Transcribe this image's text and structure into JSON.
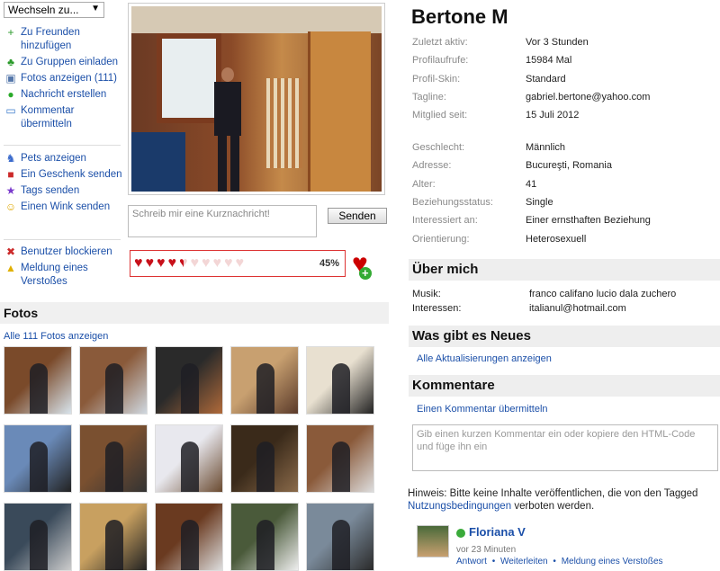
{
  "switch": {
    "label": "Wechseln zu...",
    "arrow": "▼"
  },
  "menu1": [
    {
      "icon": "add-friend-icon",
      "glyph": "+",
      "color": "#2a9a2a",
      "label": "Zu Freunden hinzufügen"
    },
    {
      "icon": "group-invite-icon",
      "glyph": "♣",
      "color": "#2a9a2a",
      "label": "Zu Gruppen einladen"
    },
    {
      "icon": "photos-icon",
      "glyph": "▣",
      "color": "#5577aa",
      "label": "Fotos anzeigen (111)"
    },
    {
      "icon": "message-icon",
      "glyph": "●",
      "color": "#2aaa2a",
      "label": "Nachricht erstellen"
    },
    {
      "icon": "comment-icon",
      "glyph": "▭",
      "color": "#3a7acc",
      "label": "Kommentar übermitteln"
    }
  ],
  "menu2": [
    {
      "icon": "pets-icon",
      "glyph": "♞",
      "color": "#3a6acc",
      "label": "Pets anzeigen"
    },
    {
      "icon": "gift-icon",
      "glyph": "■",
      "color": "#cc2a2a",
      "label": "Ein Geschenk senden"
    },
    {
      "icon": "tags-icon",
      "glyph": "★",
      "color": "#7a3acc",
      "label": "Tags senden"
    },
    {
      "icon": "wink-icon",
      "glyph": "☺",
      "color": "#e0a800",
      "label": "Einen Wink senden"
    }
  ],
  "menu3": [
    {
      "icon": "block-icon",
      "glyph": "✖",
      "color": "#cc2a2a",
      "label": "Benutzer blockieren"
    },
    {
      "icon": "warning-icon",
      "glyph": "▲",
      "color": "#e0b000",
      "label": "Meldung eines Verstoßes"
    }
  ],
  "message": {
    "placeholder": "Schreib mir eine Kurznachricht!",
    "send": "Senden"
  },
  "rating": {
    "percent": "45%",
    "value": 45
  },
  "photos": {
    "title": "Fotos",
    "all_link": "Alle 111 Fotos anzeigen"
  },
  "profile": {
    "name": "Bertone M",
    "info1": [
      {
        "k": "Zuletzt aktiv:",
        "v": "Vor 3 Stunden"
      },
      {
        "k": "Profilaufrufe:",
        "v": "15984 Mal"
      },
      {
        "k": "Profil-Skin:",
        "v": "Standard"
      },
      {
        "k": "Tagline:",
        "v": "gabriel.bertone@yahoo.com"
      },
      {
        "k": "Mitglied seit:",
        "v": "15 Juli 2012"
      }
    ],
    "info2": [
      {
        "k": "Geschlecht:",
        "v": "Männlich"
      },
      {
        "k": "Adresse:",
        "v": "Bucureşti, Romania"
      },
      {
        "k": "Alter:",
        "v": "41"
      },
      {
        "k": "Beziehungsstatus:",
        "v": "Single"
      },
      {
        "k": "Interessiert an:",
        "v": "Einer ernsthaften Beziehung"
      },
      {
        "k": "Orientierung:",
        "v": "Heterosexuell"
      }
    ]
  },
  "about": {
    "title": "Über mich",
    "rows": [
      {
        "k": "Musik:",
        "v": "franco califano lucio dala zuchero"
      },
      {
        "k": "Interessen:",
        "v": "italianul@hotmail.com"
      }
    ]
  },
  "news": {
    "title": "Was gibt es Neues",
    "link": "Alle Aktualisierungen anzeigen"
  },
  "comments": {
    "title": "Kommentare",
    "submit_link": "Einen Kommentar übermitteln",
    "placeholder": "Gib einen kurzen Kommentar ein oder kopiere den HTML-Code und füge ihn ein",
    "notice_pre": "Hinweis: Bitte keine Inhalte veröffentlichen, die von den Tagged",
    "notice_link": "Nutzungsbedingungen",
    "notice_post": "verboten werden.",
    "entry": {
      "author": "Floriana V",
      "time": "vor 23 Minuten",
      "reply": "Antwort",
      "forward": "Weiterleiten",
      "report": "Meldung eines Verstoßes"
    }
  }
}
